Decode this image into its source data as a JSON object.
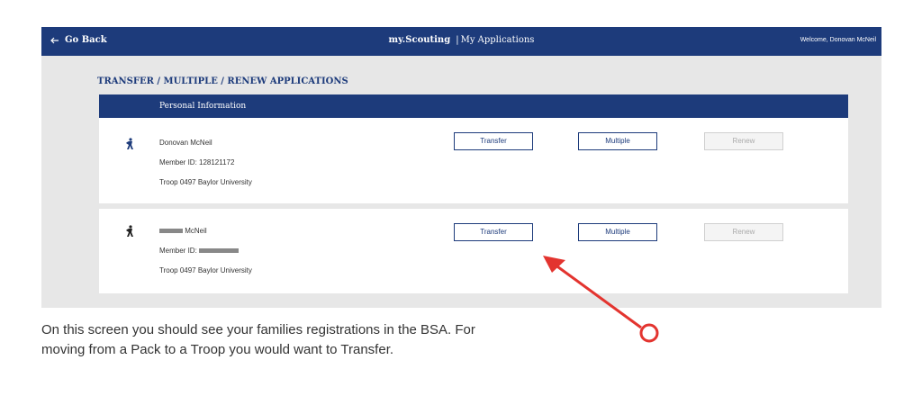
{
  "nav": {
    "back_label": "Go Back",
    "brand_name": "my.Scouting",
    "brand_separator": "|",
    "brand_section": "My Applications",
    "welcome": "Welcome, Donovan McNeil"
  },
  "page": {
    "title": "TRANSFER / MULTIPLE / RENEW APPLICATIONS",
    "table_header": "Personal Information"
  },
  "members": [
    {
      "name": "Donovan McNeil",
      "member_id": "Member ID: 128121172",
      "unit": "Troop 0497 Baylor University",
      "transfer_label": "Transfer",
      "multiple_label": "Multiple",
      "renew_label": "Renew",
      "renew_enabled": false
    },
    {
      "name_suffix": "McNeil",
      "member_id_label": "Member ID:",
      "unit": "Troop 0497 Baylor University",
      "transfer_label": "Transfer",
      "multiple_label": "Multiple",
      "renew_label": "Renew",
      "renew_enabled": false
    }
  ],
  "annotation": {
    "caption_line1": "On this screen you should see your families registrations in the BSA.  For",
    "caption_line2": "moving from a Pack to a Troop you would want to Transfer.",
    "arrow_color": "#e3342f"
  },
  "colors": {
    "brand_blue": "#1d3b7b",
    "background_gray": "#e7e7e7"
  }
}
